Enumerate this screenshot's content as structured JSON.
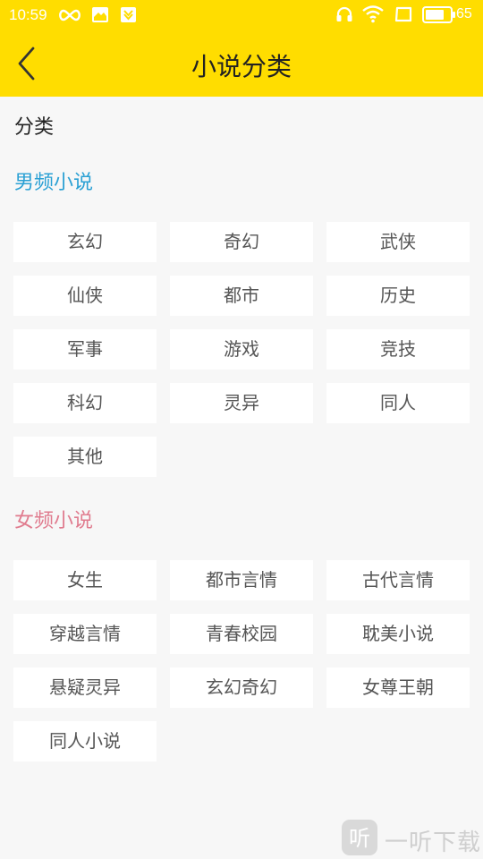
{
  "status_bar": {
    "time": "10:59",
    "battery_level": "65",
    "left_icons": [
      "infinity-icon",
      "mail-icon",
      "download-app-icon"
    ],
    "right_icons": [
      "headphones-icon",
      "wifi-icon",
      "screen-icon",
      "battery-icon"
    ]
  },
  "app_bar": {
    "title": "小说分类",
    "back_icon": "back-chevron-icon",
    "background": "#ffdd00"
  },
  "section_label": "分类",
  "male": {
    "title": "男频小说",
    "color": "#2aa0d4",
    "items": [
      "玄幻",
      "奇幻",
      "武侠",
      "仙侠",
      "都市",
      "历史",
      "军事",
      "游戏",
      "竞技",
      "科幻",
      "灵异",
      "同人",
      "其他"
    ]
  },
  "female": {
    "title": "女频小说",
    "color": "#e07b8e",
    "items": [
      "女生",
      "都市言情",
      "古代言情",
      "穿越言情",
      "青春校园",
      "耽美小说",
      "悬疑灵异",
      "玄幻奇幻",
      "女尊王朝",
      "同人小说"
    ]
  },
  "watermark": {
    "text": "一听下载",
    "logo_glyph": "听"
  }
}
